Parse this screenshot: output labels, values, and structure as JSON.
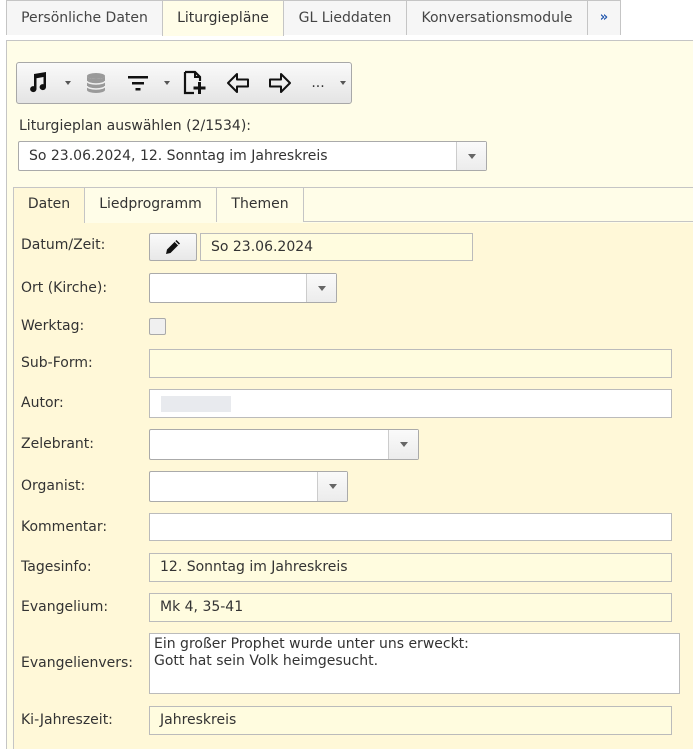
{
  "top_tabs": [
    {
      "label": "Persönliche Daten"
    },
    {
      "label": "Liturgiepläne"
    },
    {
      "label": "GL Lieddaten"
    },
    {
      "label": "Konversationsmodule"
    },
    {
      "label": "»"
    }
  ],
  "toolbar": {
    "more_label": "..."
  },
  "selector": {
    "label": "Liturgieplan auswählen (2/1534):",
    "value": "So 23.06.2024, 12. Sonntag im Jahreskreis"
  },
  "inner_tabs": [
    {
      "label": "Daten"
    },
    {
      "label": "Liedprogramm"
    },
    {
      "label": "Themen"
    }
  ],
  "form": {
    "datum_label": "Datum/Zeit:",
    "datum_value": "So 23.06.2024",
    "ort_label": "Ort (Kirche):",
    "ort_value": "",
    "werktag_label": "Werktag:",
    "subform_label": "Sub-Form:",
    "subform_value": "",
    "autor_label": "Autor:",
    "zelebrant_label": "Zelebrant:",
    "zelebrant_value": "",
    "organist_label": "Organist:",
    "organist_value": "",
    "kommentar_label": "Kommentar:",
    "kommentar_value": "",
    "tagesinfo_label": "Tagesinfo:",
    "tagesinfo_value": "12. Sonntag im Jahreskreis",
    "evangelium_label": "Evangelium:",
    "evangelium_value": "Mk 4, 35-41",
    "evangelienvers_label": "Evangelienvers:",
    "evangelienvers_value": "Ein großer Prophet wurde unter uns erweckt:\nGott hat sein Volk heimgesucht.",
    "kijahreszeit_label": "Ki-Jahreszeit:",
    "kijahreszeit_value": "Jahreskreis"
  }
}
